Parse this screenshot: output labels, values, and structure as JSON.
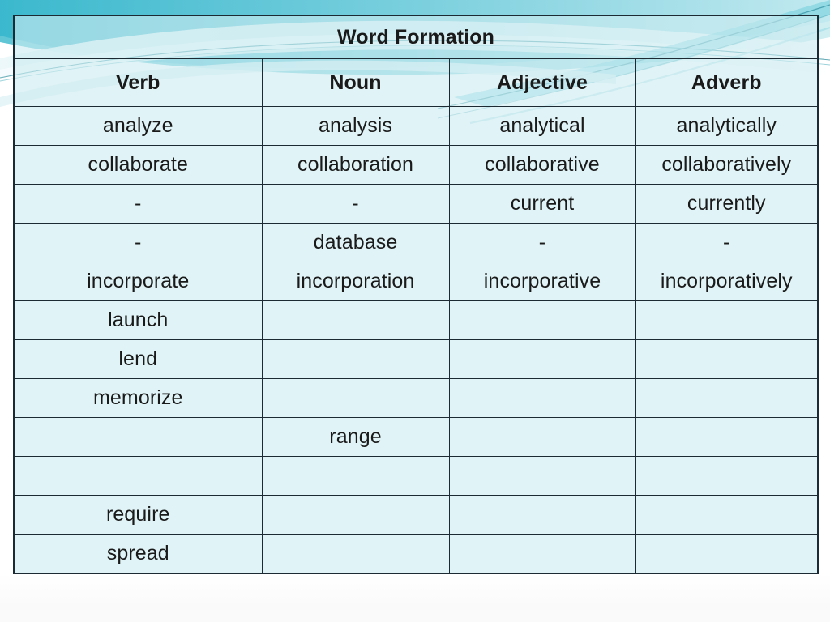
{
  "slide": {
    "title": "Word Formation",
    "theme": {
      "cell_fill": "#cdecf0",
      "border": "#1b2a33",
      "accent_red": "#d42a22",
      "text_black": "#1a1a1a",
      "swoosh_teal_dark": "#3fb9cd",
      "swoosh_teal_mid": "#7fd3df",
      "swoosh_teal_light": "#d2eef2"
    }
  },
  "table": {
    "columns": [
      "Verb",
      "Noun",
      "Adjective",
      "Adverb"
    ],
    "rows": [
      {
        "cells": [
          {
            "text": "analyze",
            "color": "black"
          },
          {
            "text": "analysis",
            "color": "red"
          },
          {
            "text": "analytical",
            "color": "red"
          },
          {
            "text": "analytically",
            "color": "red"
          }
        ]
      },
      {
        "cells": [
          {
            "text": "collaborate",
            "color": "black"
          },
          {
            "text": "collaboration",
            "color": "red"
          },
          {
            "text": "collaborative",
            "color": "red"
          },
          {
            "text": "collaboratively",
            "color": "red"
          }
        ]
      },
      {
        "cells": [
          {
            "text": "-",
            "color": "red"
          },
          {
            "text": "-",
            "color": "red"
          },
          {
            "text": "current",
            "color": "black"
          },
          {
            "text": "currently",
            "color": "red"
          }
        ]
      },
      {
        "cells": [
          {
            "text": "-",
            "color": "red"
          },
          {
            "text": "database",
            "color": "black"
          },
          {
            "text": "-",
            "color": "red"
          },
          {
            "text": "-",
            "color": "red"
          }
        ]
      },
      {
        "cells": [
          {
            "text": "incorporate",
            "color": "black"
          },
          {
            "text": "incorporation",
            "color": "red"
          },
          {
            "text": "incorporative",
            "color": "red"
          },
          {
            "text": "incorporatively",
            "color": "red"
          }
        ]
      },
      {
        "cells": [
          {
            "text": "launch",
            "color": "black"
          },
          {
            "text": "",
            "color": "black"
          },
          {
            "text": "",
            "color": "black"
          },
          {
            "text": "",
            "color": "black"
          }
        ]
      },
      {
        "cells": [
          {
            "text": "lend",
            "color": "black"
          },
          {
            "text": "",
            "color": "black"
          },
          {
            "text": "",
            "color": "black"
          },
          {
            "text": "",
            "color": "black"
          }
        ]
      },
      {
        "cells": [
          {
            "text": "memorize",
            "color": "black"
          },
          {
            "text": "",
            "color": "black"
          },
          {
            "text": "",
            "color": "black"
          },
          {
            "text": "",
            "color": "black"
          }
        ]
      },
      {
        "cells": [
          {
            "text": "",
            "color": "black"
          },
          {
            "text": "range",
            "color": "black"
          },
          {
            "text": "",
            "color": "black"
          },
          {
            "text": "",
            "color": "black"
          }
        ]
      },
      {
        "cells": [
          {
            "text": "",
            "color": "black"
          },
          {
            "text": "",
            "color": "black"
          },
          {
            "text": "",
            "color": "black"
          },
          {
            "text": "",
            "color": "black"
          }
        ]
      },
      {
        "cells": [
          {
            "text": "require",
            "color": "black"
          },
          {
            "text": "",
            "color": "black"
          },
          {
            "text": "",
            "color": "black"
          },
          {
            "text": "",
            "color": "black"
          }
        ]
      },
      {
        "cells": [
          {
            "text": "spread",
            "color": "black"
          },
          {
            "text": "",
            "color": "black"
          },
          {
            "text": "",
            "color": "black"
          },
          {
            "text": "",
            "color": "black"
          }
        ]
      }
    ]
  }
}
